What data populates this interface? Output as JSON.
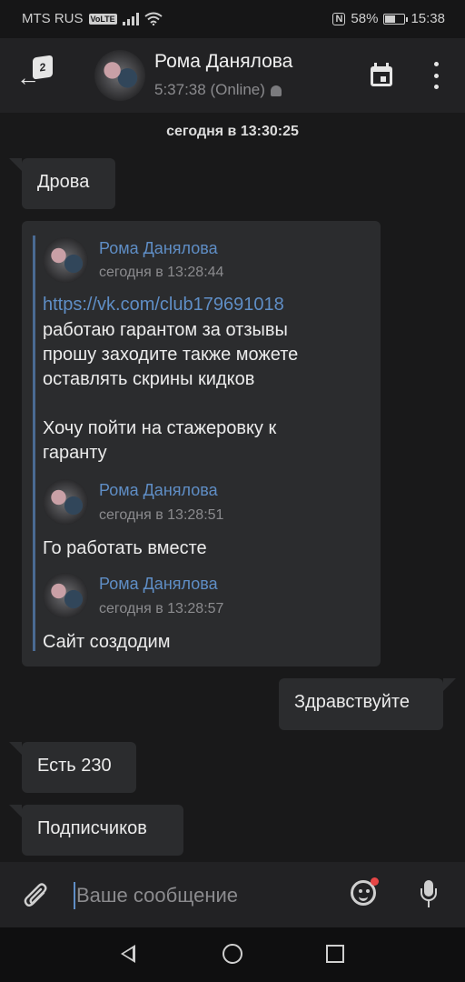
{
  "status_bar": {
    "carrier": "MTS RUS",
    "volte": "VoLTE",
    "nfc": "N",
    "battery_text": "58%",
    "battery_level": 0.58,
    "time": "15:38"
  },
  "header": {
    "unread_count": "2",
    "contact_name": "Рома Данялова",
    "contact_status": "5:37:38 (Online)"
  },
  "chat": {
    "date_separator": "сегодня в 13:30:25",
    "messages": [
      {
        "direction": "in",
        "text": "Дрова"
      },
      {
        "direction": "out",
        "text": "Здравствуйте"
      },
      {
        "direction": "in",
        "text": "Есть 230"
      },
      {
        "direction": "in",
        "text": "Подписчиков"
      }
    ],
    "forwarded": [
      {
        "author": "Рома Данялова",
        "time": "сегодня в 13:28:44",
        "link": "https://vk.com/club179691018",
        "lines": [
          "работаю гарантом за отзывы",
          "прошу заходите также можете",
          "оставлять скрины кидков",
          "",
          "Хочу пойти на стажеровку к",
          "гаранту"
        ]
      },
      {
        "author": "Рома Данялова",
        "time": "сегодня в 13:28:51",
        "text": "Го работать вместе"
      },
      {
        "author": "Рома Данялова",
        "time": "сегодня в 13:28:57",
        "text": "Сайт создодим"
      }
    ]
  },
  "composer": {
    "placeholder": "Ваше сообщение",
    "value": ""
  },
  "icons": {
    "back": "arrow-left-icon",
    "calendar": "calendar-icon",
    "more": "more-vertical-icon",
    "attach": "paperclip-icon",
    "emoji": "smiley-icon",
    "mic": "microphone-icon",
    "platform": "android-icon"
  },
  "colors": {
    "background": "#19191a",
    "bubble": "#2b2c2e",
    "accent": "#5f8ec6",
    "header": "#222224"
  }
}
